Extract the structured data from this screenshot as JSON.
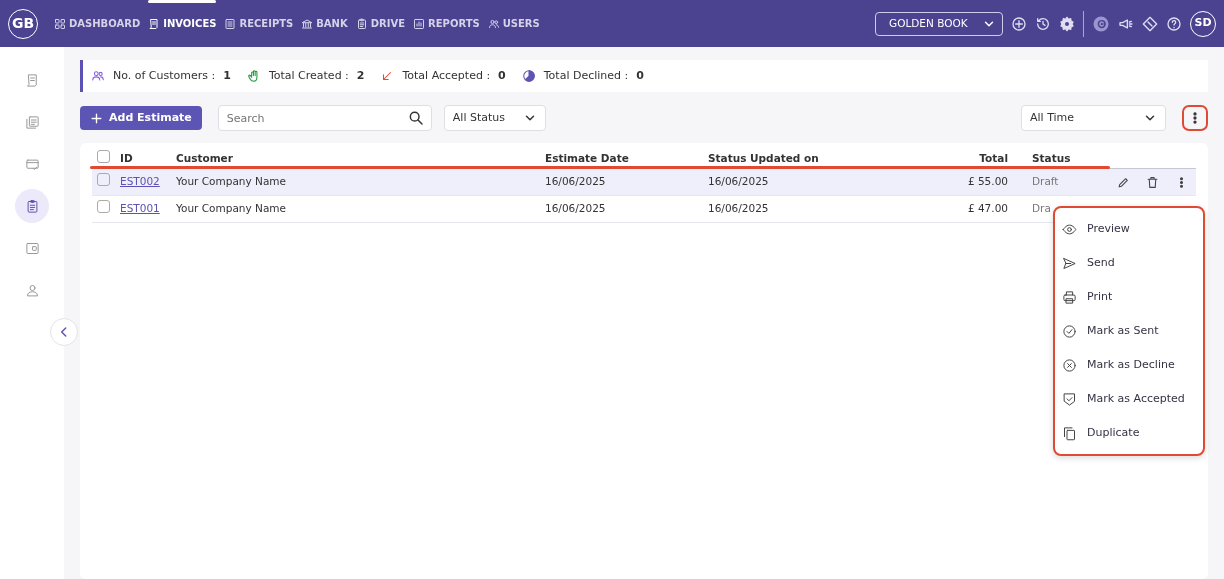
{
  "navbar": {
    "logo": "GB",
    "items": [
      {
        "label": "DASHBOARD",
        "selected": false
      },
      {
        "label": "INVOICES",
        "selected": true
      },
      {
        "label": "RECEIPTS",
        "selected": false
      },
      {
        "label": "BANK",
        "selected": false
      },
      {
        "label": "DRIVE",
        "selected": false
      },
      {
        "label": "REPORTS",
        "selected": false
      },
      {
        "label": "USERS",
        "selected": false
      }
    ],
    "company": "GOLDEN BOOK",
    "avatar": "SD"
  },
  "sidebar": {
    "items": [
      {
        "selected": false
      },
      {
        "selected": false
      },
      {
        "selected": false
      },
      {
        "selected": true
      },
      {
        "selected": false
      },
      {
        "selected": false
      }
    ]
  },
  "stats": [
    {
      "label": "No. of Customers :",
      "value": "1"
    },
    {
      "label": "Total Created :",
      "value": "2"
    },
    {
      "label": "Total Accepted :",
      "value": "0"
    },
    {
      "label": "Total Declined :",
      "value": "0"
    }
  ],
  "toolbar": {
    "add_button": "Add Estimate",
    "search": {
      "placeholder": "Search"
    },
    "status_filter": "All Status",
    "time_filter": "All Time"
  },
  "table": {
    "select_all_checked": false,
    "columns": [
      "ID",
      "Customer",
      "Estimate Date",
      "Status Updated on",
      "Total",
      "Status"
    ],
    "rows": [
      {
        "id": "EST002",
        "customer": "Your Company Name",
        "estimate_date": "16/06/2025",
        "status_updated": "16/06/2025",
        "total": "£ 55.00",
        "status": "Draft",
        "checked": false,
        "hovered": true
      },
      {
        "id": "EST001",
        "customer": "Your Company Name",
        "estimate_date": "16/06/2025",
        "status_updated": "16/06/2025",
        "total": "£ 47.00",
        "status": "Dra",
        "checked": false,
        "hovered": false
      }
    ]
  },
  "row_menu": {
    "items": [
      {
        "label": "Preview"
      },
      {
        "label": "Send"
      },
      {
        "label": "Print"
      },
      {
        "label": "Mark as Sent"
      },
      {
        "label": "Mark as Decline"
      },
      {
        "label": "Mark as Accepted"
      },
      {
        "label": "Duplicate"
      }
    ]
  }
}
